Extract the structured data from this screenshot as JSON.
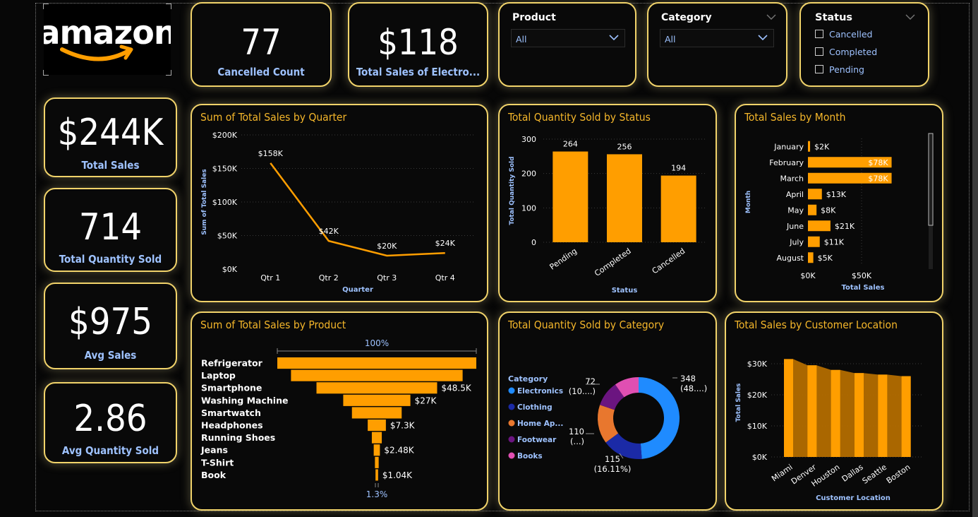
{
  "logo": {
    "text": "amazon"
  },
  "kpis": {
    "cancelled_count": {
      "value": "77",
      "label": "Cancelled Count"
    },
    "total_sales_electronics": {
      "value": "$118",
      "label": "Total Sales of Electro..."
    },
    "total_sales": {
      "value": "$244K",
      "label": "Total Sales"
    },
    "total_quantity": {
      "value": "714",
      "label": "Total Quantity Sold"
    },
    "avg_sales": {
      "value": "$975",
      "label": "Avg Sales"
    },
    "avg_quantity": {
      "value": "2.86",
      "label": "Avg Quantity Sold"
    }
  },
  "slicers": {
    "product": {
      "title": "Product",
      "selected": "All"
    },
    "category": {
      "title": "Category",
      "selected": "All"
    },
    "status": {
      "title": "Status",
      "options": [
        "Cancelled",
        "Completed",
        "Pending"
      ]
    }
  },
  "colors": {
    "accent": "#ff9e00",
    "border": "#f1d36a",
    "title": "#f4b62a",
    "label_blue": "#9ec2ff"
  },
  "chart_data": [
    {
      "id": "quarter",
      "type": "line",
      "title": "Sum of Total Sales by Quarter",
      "xlabel": "Quarter",
      "ylabel": "Sum of Total Sales",
      "categories": [
        "Qtr 1",
        "Qtr 2",
        "Qtr 3",
        "Qtr 4"
      ],
      "values": [
        158,
        42,
        20,
        24
      ],
      "data_labels": [
        "$158K",
        "$42K",
        "$20K",
        "$24K"
      ],
      "yticks": [
        "$0K",
        "$50K",
        "$100K",
        "$150K",
        "$200K"
      ],
      "ylim": [
        0,
        200
      ]
    },
    {
      "id": "status",
      "type": "bar",
      "title": "Total Quantity Sold by Status",
      "xlabel": "Status",
      "ylabel": "Total Quantity Sold",
      "categories": [
        "Pending",
        "Completed",
        "Cancelled"
      ],
      "values": [
        264,
        256,
        194
      ],
      "yticks": [
        "0",
        "100",
        "200",
        "300"
      ],
      "ylim": [
        0,
        300
      ]
    },
    {
      "id": "month",
      "type": "bar",
      "orientation": "horizontal",
      "title": "Total Sales by Month",
      "xlabel": "Total Sales",
      "ylabel": "Month",
      "categories": [
        "January",
        "February",
        "March",
        "April",
        "May",
        "June",
        "July",
        "August"
      ],
      "values": [
        2,
        78,
        78,
        13,
        8,
        21,
        11,
        5
      ],
      "data_labels": [
        "$2K",
        "$78K",
        "$78K",
        "$13K",
        "$8K",
        "$21K",
        "$11K",
        "$5K"
      ],
      "xticks": [
        "$0K",
        "$50K"
      ],
      "xlim": [
        0,
        100
      ]
    },
    {
      "id": "product",
      "type": "bar",
      "orientation": "funnel",
      "title": "Sum of Total Sales by Product",
      "categories": [
        "Refrigerator",
        "Laptop",
        "Smartphone",
        "Washing Machine",
        "Smartwatch",
        "Headphones",
        "Running Shoes",
        "Jeans",
        "T-Shirt",
        "Book"
      ],
      "values": [
        80,
        69,
        48.5,
        27,
        20,
        7.3,
        4,
        2.48,
        1.5,
        1.04
      ],
      "data_labels": [
        "",
        "",
        "$48.5K",
        "$27K",
        "",
        "$7.3K",
        "",
        "$2.48K",
        "",
        "$1.04K"
      ],
      "top_percent": "100%",
      "bottom_percent": "1.3%"
    },
    {
      "id": "category",
      "type": "pie",
      "title": "Total Quantity Sold by Category",
      "legend_title": "Category",
      "categories": [
        "Electronics",
        "Clothing",
        "Home Ap...",
        "Footwear",
        "Books"
      ],
      "values": [
        348,
        115,
        110,
        72,
        69
      ],
      "slice_colors": [
        "#1f8bff",
        "#1b2aa6",
        "#e8772e",
        "#6b1580",
        "#e04fb2"
      ],
      "data_labels": [
        {
          "value": "348",
          "pct": "(48....)"
        },
        {
          "value": "115",
          "pct": "(16.11%)"
        },
        {
          "value": "110",
          "pct": "(...)"
        },
        {
          "value": "72",
          "pct": "(10....)"
        }
      ]
    },
    {
      "id": "location",
      "type": "bar",
      "title": "Total Sales by Customer Location",
      "xlabel": "Customer Location",
      "ylabel": "Total Sales",
      "categories": [
        "Miami",
        "Denver",
        "Houston",
        "Dallas",
        "Seattle",
        "Boston"
      ],
      "values": [
        31.5,
        29.5,
        28,
        27,
        26.5,
        26
      ],
      "yticks": [
        "$0K",
        "$10K",
        "$20K",
        "$30K"
      ],
      "ylim": [
        0,
        35
      ]
    }
  ]
}
